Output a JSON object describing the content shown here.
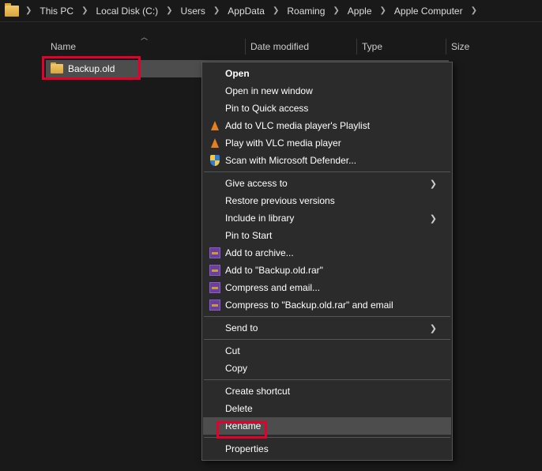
{
  "breadcrumb": [
    "This PC",
    "Local Disk (C:)",
    "Users",
    "AppData",
    "Roaming",
    "Apple",
    "Apple Computer"
  ],
  "columns": {
    "name": "Name",
    "date": "Date modified",
    "type": "Type",
    "size": "Size"
  },
  "file": {
    "name": "Backup.old"
  },
  "menu": {
    "g1": [
      {
        "label": "Open",
        "bold": true
      },
      {
        "label": "Open in new window"
      },
      {
        "label": "Pin to Quick access"
      },
      {
        "label": "Add to VLC media player's Playlist",
        "icon": "vlc"
      },
      {
        "label": "Play with VLC media player",
        "icon": "vlc"
      },
      {
        "label": "Scan with Microsoft Defender...",
        "icon": "shield"
      }
    ],
    "g2": [
      {
        "label": "Give access to",
        "submenu": true
      },
      {
        "label": "Restore previous versions"
      },
      {
        "label": "Include in library",
        "submenu": true
      },
      {
        "label": "Pin to Start"
      },
      {
        "label": "Add to archive...",
        "icon": "rar"
      },
      {
        "label": "Add to \"Backup.old.rar\"",
        "icon": "rar"
      },
      {
        "label": "Compress and email...",
        "icon": "rar"
      },
      {
        "label": "Compress to \"Backup.old.rar\" and email",
        "icon": "rar"
      }
    ],
    "g3": [
      {
        "label": "Send to",
        "submenu": true
      }
    ],
    "g4": [
      {
        "label": "Cut"
      },
      {
        "label": "Copy"
      }
    ],
    "g5": [
      {
        "label": "Create shortcut"
      },
      {
        "label": "Delete"
      },
      {
        "label": "Rename",
        "highlight": true
      }
    ],
    "g6": [
      {
        "label": "Properties"
      }
    ]
  }
}
